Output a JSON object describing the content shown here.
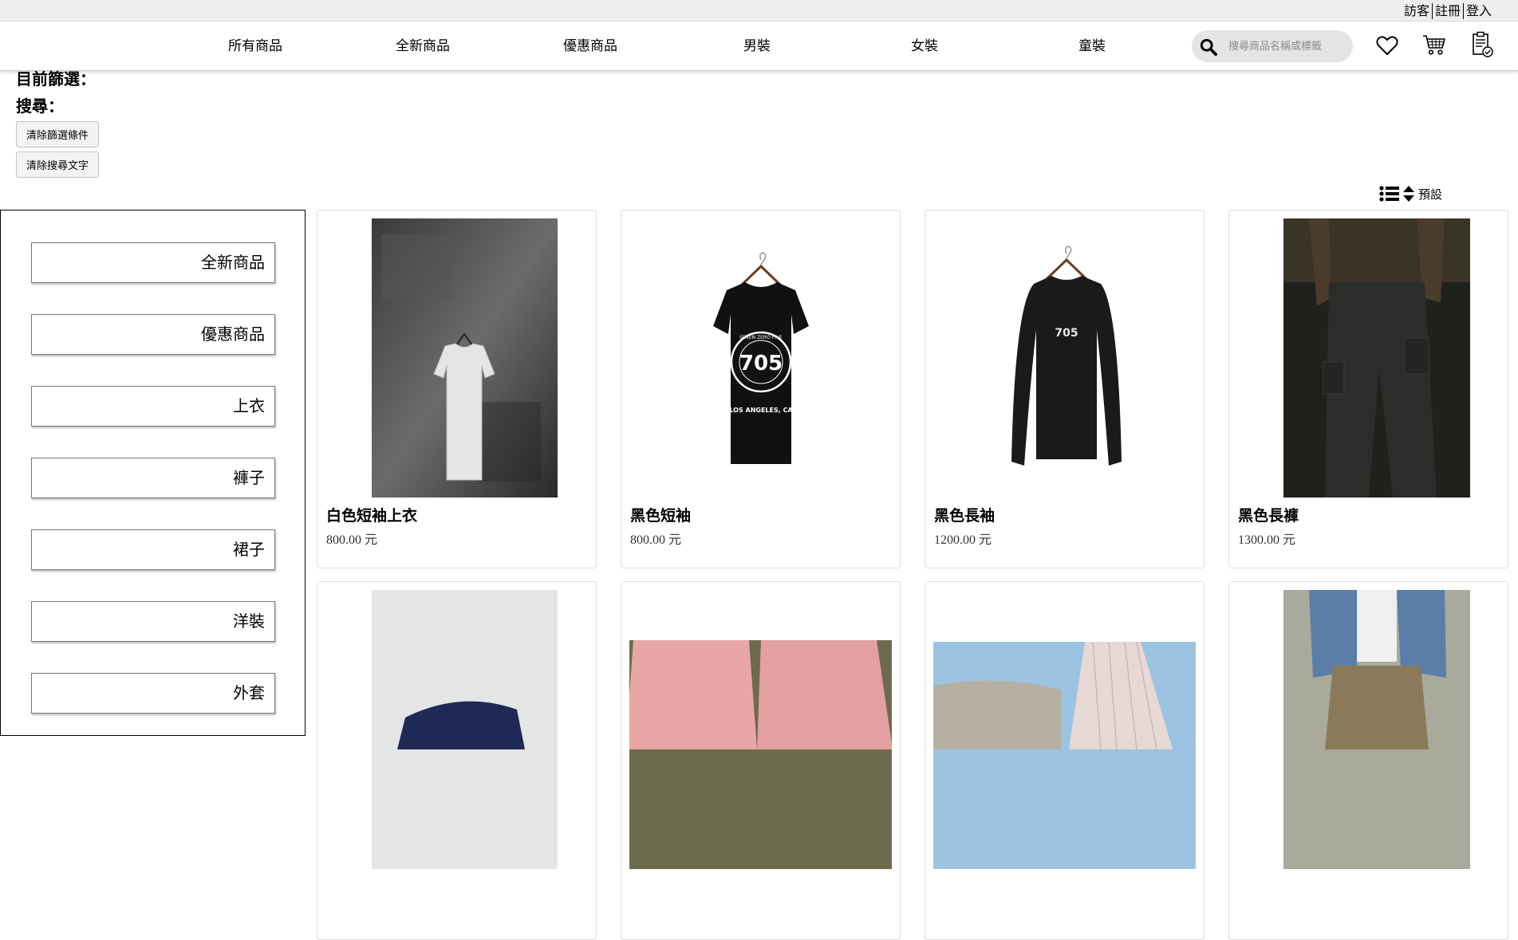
{
  "top_links": {
    "guest": "訪客",
    "register": "註冊",
    "login": "登入"
  },
  "nav": {
    "items": [
      "所有商品",
      "全新商品",
      "優惠商品",
      "男裝",
      "女裝",
      "童裝"
    ],
    "search_placeholder": "搜尋商品名稱或標籤",
    "icons": [
      "search-icon",
      "heart-icon",
      "cart-icon",
      "order-list-icon"
    ]
  },
  "filter": {
    "current_label": "目前篩選：",
    "search_label": "搜尋：",
    "clear_filter_button": "清除篩選條件",
    "clear_search_button": "清除搜尋文字"
  },
  "sort": {
    "label": "預設",
    "icons": [
      "list-icon",
      "sort-icon"
    ]
  },
  "sidebar": {
    "categories": [
      "全新商品",
      "優惠商品",
      "上衣",
      "褲子",
      "裙子",
      "洋裝",
      "外套"
    ]
  },
  "products": [
    {
      "name": "白色短袖上衣",
      "price": "800.00 元"
    },
    {
      "name": "黑色短袖",
      "price": "800.00 元"
    },
    {
      "name": "黑色長袖",
      "price": "1200.00 元"
    },
    {
      "name": "黑色長褲",
      "price": "1300.00 元"
    },
    {
      "name": "",
      "price": ""
    },
    {
      "name": "",
      "price": ""
    },
    {
      "name": "",
      "price": ""
    },
    {
      "name": "",
      "price": ""
    }
  ],
  "product_image_text": {
    "tee_logo_number": "705",
    "tee_logo_ring": "SEVEN ZERO FIVE",
    "tee_caption": "LOS ANGELES, CA",
    "longsleeve_logo": "705"
  },
  "colors": {
    "topbar": "#eeeeee",
    "search_bg": "#e4e4e4",
    "border": "#dedede"
  }
}
